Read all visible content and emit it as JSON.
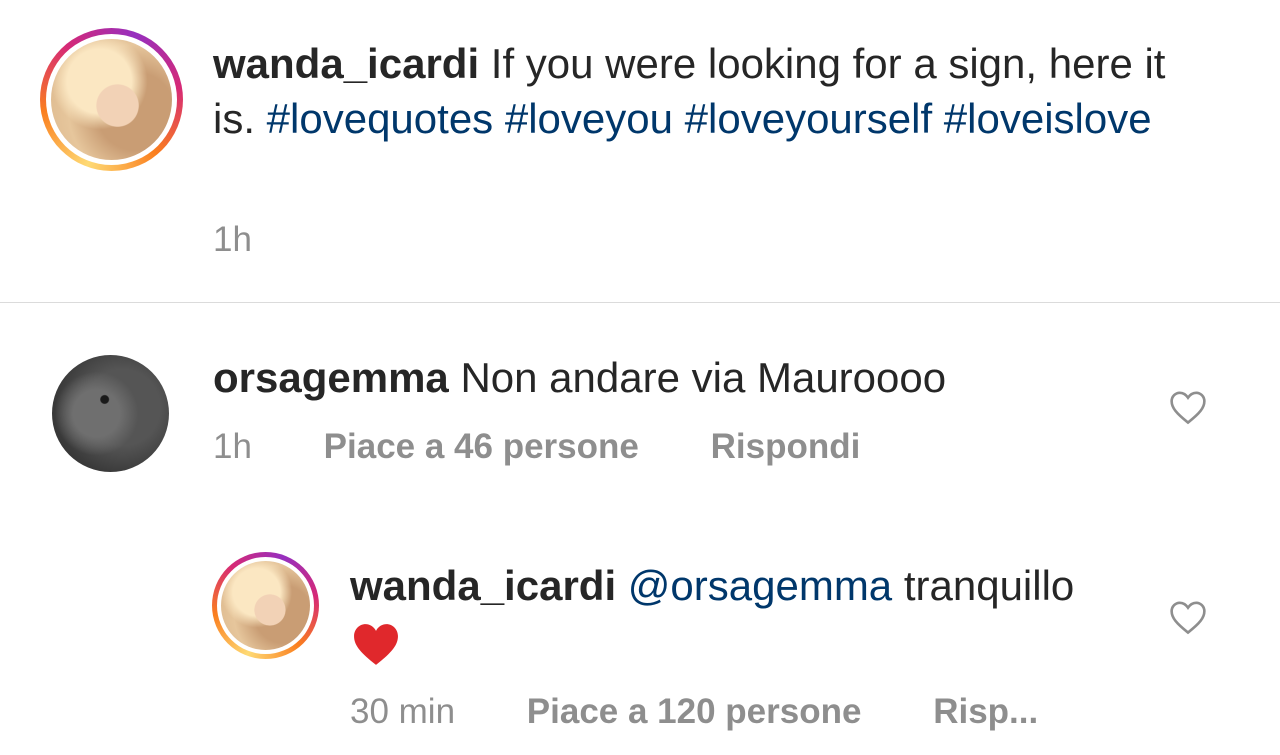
{
  "caption": {
    "username": "wanda_icardi",
    "text": "If you were looking for a sign, here it is.",
    "hashtags": [
      "#lovequotes",
      "#loveyou",
      "#loveyourself",
      "#loveislove"
    ],
    "time": "1h"
  },
  "comments": [
    {
      "username": "orsagemma",
      "text": "Non andare via Mauroooo",
      "time": "1h",
      "likes": "Piace a 46 persone",
      "reply": "Rispondi",
      "avatar_icon": "rabbit-avatar"
    },
    {
      "username": "wanda_icardi",
      "mention": "@orsagemma",
      "text": "tranquillo",
      "emoji": "red-heart-icon",
      "time": "30 min",
      "likes": "Piace a 120 persone",
      "reply": "Risp..."
    }
  ],
  "colors": {
    "hashtag": "#00376b",
    "meta": "#8e8e8e",
    "heart_red": "#e0282c"
  }
}
